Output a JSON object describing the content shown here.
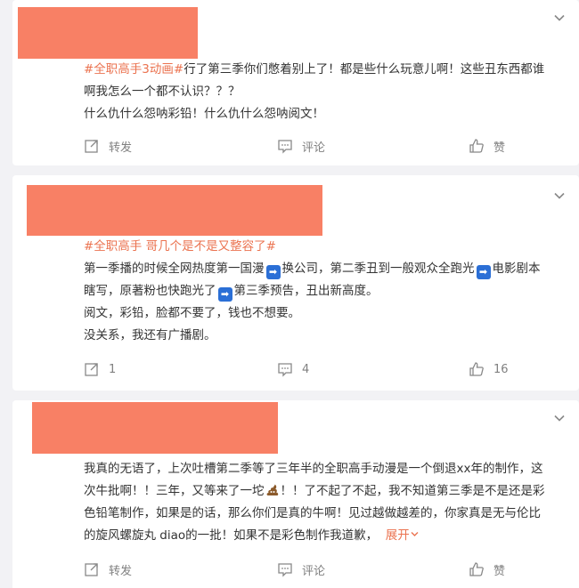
{
  "colors": {
    "background": "#f2f2f5",
    "card": "#ffffff",
    "redaction": "#f88065",
    "tag": "#eb7350",
    "text": "#333333",
    "action_text": "#808080"
  },
  "posts": [
    {
      "tag": "#全职高手3动画#",
      "lines": [
        "行了第三季你们憋着别上了！都是些什么玩意儿啊！这些丑东西都谁",
        "啊我怎么一个都不认识？？？",
        "什么仇什么怨呐彩铅！什么仇什么怨呐阅文！"
      ],
      "repost": "转发",
      "comment": "评论",
      "like": "赞"
    },
    {
      "tag": "#全职高手 哥几个是不是又整容了#",
      "seg1": "第一季播的时候全网热度第一国漫",
      "seg2": "换公司，第二季丑到一般观众全跑光",
      "seg3": "电影剧本",
      "seg4": "瞎写，原著粉也快跑光了",
      "seg5": "第三季预告，丑出新高度。",
      "line3": "阅文，彩铅，脸都不要了，钱也不想要。",
      "line4": "没关系，我还有广播剧。",
      "repost": "1",
      "comment": "4",
      "like": "16"
    },
    {
      "text_a": "我真的无语了，上次吐槽第二季等了三年半的全职高手动漫是一个倒退xx年的制作，这",
      "text_b": "次牛批啊！！三年，又等来了一坨",
      "text_c": "！！了不起了不起，我不知道第三季是不是还是彩",
      "text_d": "色铅笔制作，如果是的话，那么你们是真的牛啊！见过越做越差的，你家真是无与伦比",
      "text_e": "的旋风螺旋丸 diao的一批！如果不是彩色制作我道歉，",
      "more": "展开",
      "repost": "转发",
      "comment": "评论",
      "like": "赞"
    }
  ]
}
